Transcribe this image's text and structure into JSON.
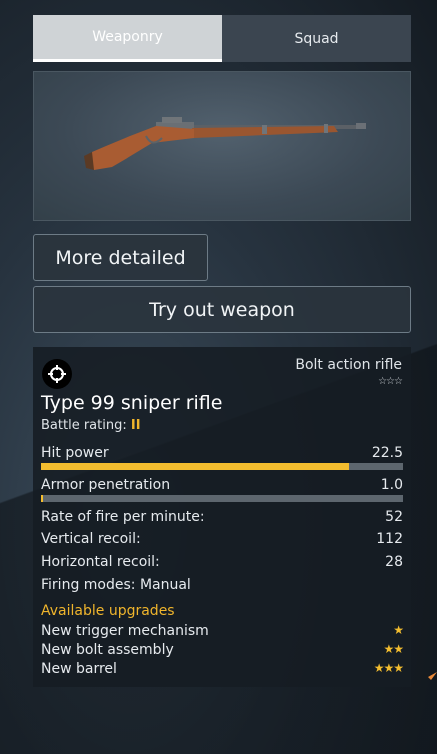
{
  "tabs": [
    {
      "label": "Weaponry",
      "active": true
    },
    {
      "label": "Squad",
      "active": false
    }
  ],
  "buttons": {
    "more_detailed": "More detailed",
    "try_out": "Try out weapon"
  },
  "weapon": {
    "type": "Bolt action rifle",
    "type_stars": "☆☆☆",
    "name": "Type 99 sniper rifle",
    "battle_rating_label": "Battle rating:",
    "battle_rating_value": "II",
    "icon": "crosshair-icon"
  },
  "stats": {
    "hit_power": {
      "label": "Hit power",
      "value": "22.5",
      "fill_percent": 85
    },
    "armor_penetration": {
      "label": "Armor penetration",
      "value": "1.0",
      "fill_percent": 0.5
    },
    "rate_of_fire": {
      "label": "Rate of fire per minute:",
      "value": "52"
    },
    "vertical_recoil": {
      "label": "Vertical recoil:",
      "value": "112"
    },
    "horizontal_recoil": {
      "label": "Horizontal recoil:",
      "value": "28"
    },
    "firing_modes": {
      "label": "Firing modes: Manual"
    }
  },
  "upgrades": {
    "title": "Available upgrades",
    "items": [
      {
        "label": "New trigger mechanism",
        "stars": "★"
      },
      {
        "label": "New bolt assembly",
        "stars": "★★"
      },
      {
        "label": "New barrel",
        "stars": "★★★"
      }
    ]
  },
  "colors": {
    "accent": "#f3bd2f",
    "panel": "#161c23",
    "tab_active": "#cfd3d6"
  }
}
